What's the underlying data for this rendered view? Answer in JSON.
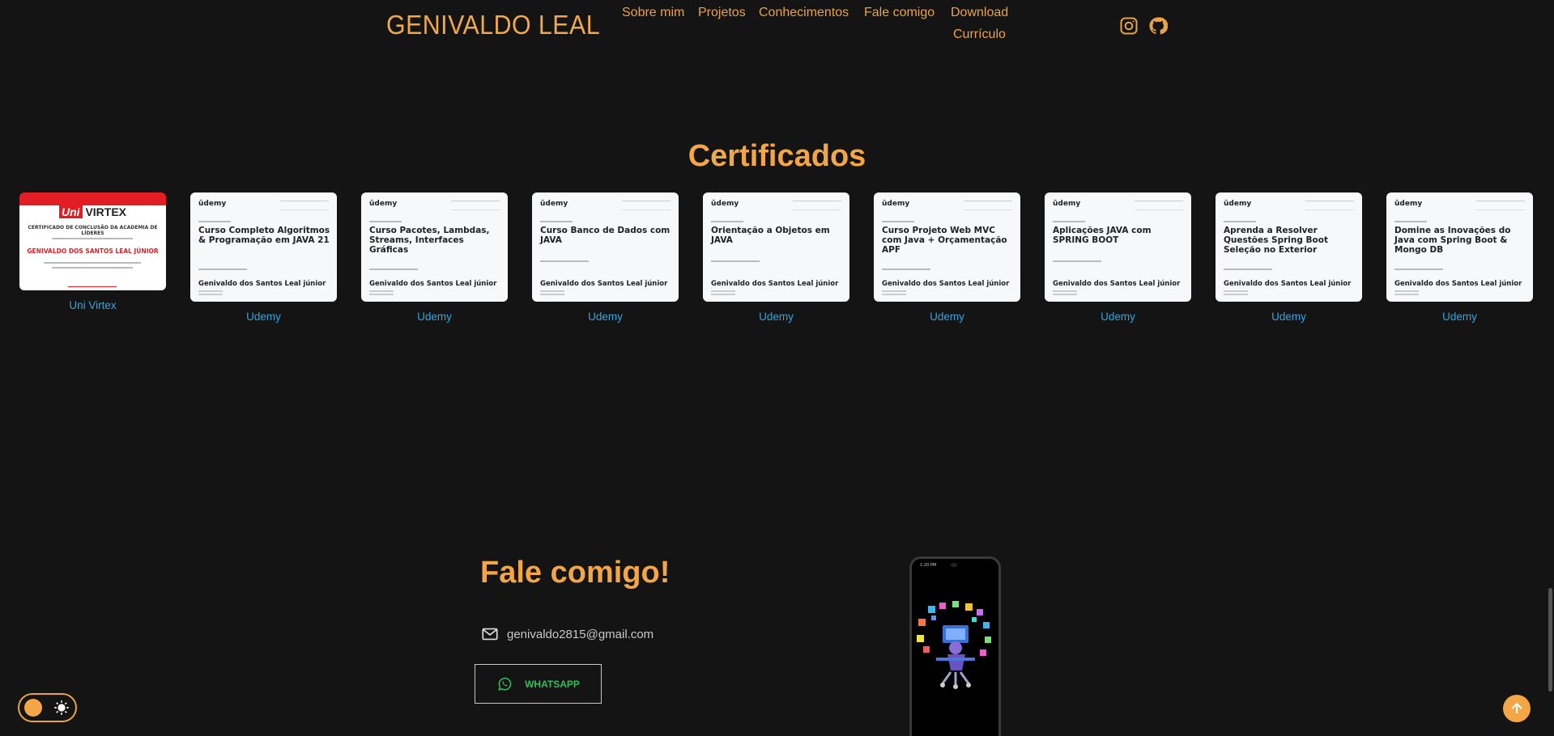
{
  "brand": "GENIVALDO LEAL",
  "menu": [
    {
      "label": "Sobre mim"
    },
    {
      "label": "Projetos"
    },
    {
      "label": "Conhecimentos"
    },
    {
      "label": "Fale comigo"
    },
    {
      "label_line1": "Download",
      "label_line2": "Currículo"
    }
  ],
  "social": {
    "instagram": "instagram-icon",
    "github": "github-icon"
  },
  "certificates": {
    "title": "Certificados",
    "univirtex": {
      "logo_uni": "Uni",
      "logo_virtex": "VIRTEX",
      "heading": "CERTIFICADO DE CONCLUSÃO DA ACADEMIA DE LÍDERES",
      "name": "GENIVALDO DOS SANTOS LEAL JÚNIOR",
      "label": "Uni Virtex"
    },
    "udemy_logo": "ūdemy",
    "udemy_name": "Genivaldo dos Santos Leal júnior",
    "items": [
      {
        "title": "Curso Completo Algoritmos & Programação em JAVA 21",
        "label": "Udemy"
      },
      {
        "title": "Curso Pacotes, Lambdas, Streams, Interfaces Gráficas",
        "label": "Udemy"
      },
      {
        "title": "Curso Banco de Dados com JAVA",
        "label": "Udemy"
      },
      {
        "title": "Orientação a Objetos em JAVA",
        "label": "Udemy"
      },
      {
        "title": "Curso Projeto Web MVC com Java + Orçamentação APF",
        "label": "Udemy"
      },
      {
        "title": "Aplicações JAVA com SPRING BOOT",
        "label": "Udemy"
      },
      {
        "title": "Aprenda a Resolver Questões Spring Boot Seleção no Exterior",
        "label": "Udemy"
      },
      {
        "title": "Domine as Inovações do Java com Spring Boot & Mongo DB",
        "label": "Udemy"
      }
    ]
  },
  "contact": {
    "title": "Fale comigo!",
    "email": "genivaldo2815@gmail.com",
    "whatsapp_label": "WHATSAPP"
  },
  "phone": {
    "status_time": "1:20 PM"
  },
  "colors": {
    "accent": "#f3a646",
    "link": "#2fa6e0",
    "whatsapp": "#2ec15a",
    "background": "#141414"
  }
}
